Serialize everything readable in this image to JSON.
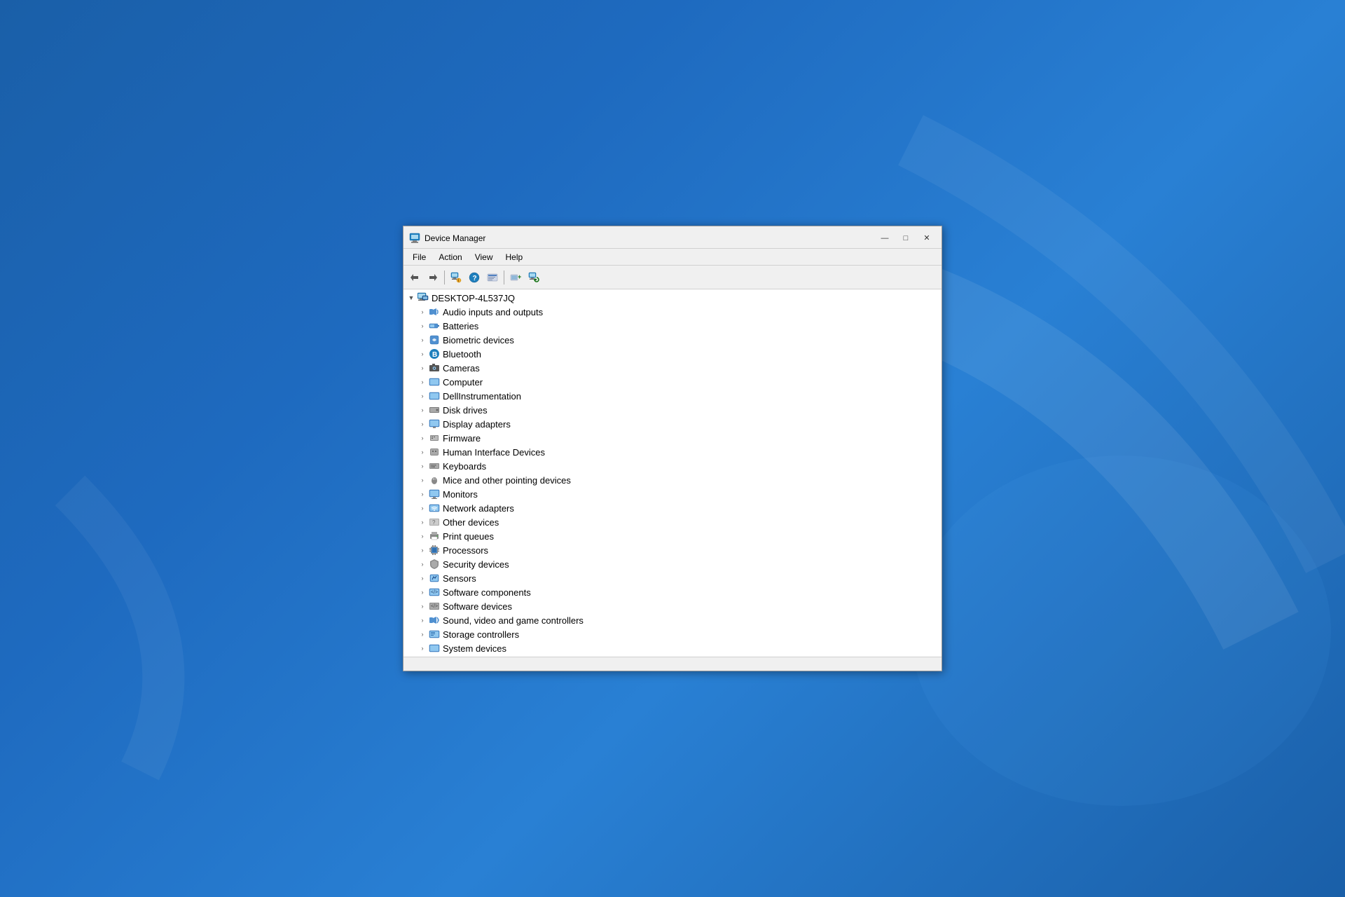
{
  "window": {
    "title": "Device Manager",
    "title_icon": "💻"
  },
  "title_controls": {
    "minimize": "—",
    "maximize": "□",
    "close": "✕"
  },
  "menu": {
    "items": [
      "File",
      "Action",
      "View",
      "Help"
    ]
  },
  "toolbar": {
    "buttons": [
      {
        "name": "back-button",
        "icon": "◄",
        "disabled": false
      },
      {
        "name": "forward-button",
        "icon": "►",
        "disabled": false
      },
      {
        "name": "properties-button",
        "icon": "🖥",
        "disabled": false
      },
      {
        "name": "help-button",
        "icon": "❓",
        "disabled": false
      },
      {
        "name": "driver-info-button",
        "icon": "📋",
        "disabled": false
      },
      {
        "name": "add-hardware-button",
        "icon": "➕",
        "disabled": false
      },
      {
        "name": "scan-button",
        "icon": "🖥",
        "disabled": false
      }
    ]
  },
  "tree": {
    "root": {
      "label": "DESKTOP-4L537JQ",
      "expanded": true
    },
    "items": [
      {
        "id": 1,
        "label": "Audio inputs and outputs",
        "icon": "audio",
        "indent": 2
      },
      {
        "id": 2,
        "label": "Batteries",
        "icon": "battery",
        "indent": 2
      },
      {
        "id": 3,
        "label": "Biometric devices",
        "icon": "biometric",
        "indent": 2
      },
      {
        "id": 4,
        "label": "Bluetooth",
        "icon": "bluetooth",
        "indent": 2
      },
      {
        "id": 5,
        "label": "Cameras",
        "icon": "camera",
        "indent": 2
      },
      {
        "id": 6,
        "label": "Computer",
        "icon": "computer",
        "indent": 2
      },
      {
        "id": 7,
        "label": "DellInstrumentation",
        "icon": "dell",
        "indent": 2
      },
      {
        "id": 8,
        "label": "Disk drives",
        "icon": "disk",
        "indent": 2
      },
      {
        "id": 9,
        "label": "Display adapters",
        "icon": "display",
        "indent": 2
      },
      {
        "id": 10,
        "label": "Firmware",
        "icon": "firmware",
        "indent": 2
      },
      {
        "id": 11,
        "label": "Human Interface Devices",
        "icon": "hid",
        "indent": 2
      },
      {
        "id": 12,
        "label": "Keyboards",
        "icon": "keyboard",
        "indent": 2
      },
      {
        "id": 13,
        "label": "Mice and other pointing devices",
        "icon": "mouse",
        "indent": 2
      },
      {
        "id": 14,
        "label": "Monitors",
        "icon": "monitor",
        "indent": 2
      },
      {
        "id": 15,
        "label": "Network adapters",
        "icon": "network",
        "indent": 2
      },
      {
        "id": 16,
        "label": "Other devices",
        "icon": "other",
        "indent": 2
      },
      {
        "id": 17,
        "label": "Print queues",
        "icon": "print",
        "indent": 2
      },
      {
        "id": 18,
        "label": "Processors",
        "icon": "processor",
        "indent": 2
      },
      {
        "id": 19,
        "label": "Security devices",
        "icon": "security",
        "indent": 2
      },
      {
        "id": 20,
        "label": "Sensors",
        "icon": "sensor",
        "indent": 2
      },
      {
        "id": 21,
        "label": "Software components",
        "icon": "software_comp",
        "indent": 2
      },
      {
        "id": 22,
        "label": "Software devices",
        "icon": "software_dev",
        "indent": 2
      },
      {
        "id": 23,
        "label": "Sound, video and game controllers",
        "icon": "sound",
        "indent": 2
      },
      {
        "id": 24,
        "label": "Storage controllers",
        "icon": "storage",
        "indent": 2
      },
      {
        "id": 25,
        "label": "System devices",
        "icon": "system",
        "indent": 2
      }
    ]
  },
  "statusbar": {
    "text": ""
  }
}
